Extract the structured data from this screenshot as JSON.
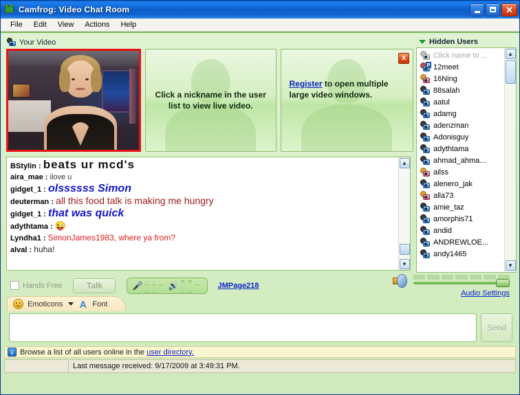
{
  "window": {
    "title": "Camfrog: Video Chat Room",
    "icon": "camfrog-logo-icon",
    "minimize_label": "Minimize",
    "maximize_label": "Maximize",
    "close_label": "Close"
  },
  "menu": {
    "items": [
      "File",
      "Edit",
      "View",
      "Actions",
      "Help"
    ]
  },
  "video": {
    "my_video_label": "Your Video",
    "placeholder1": "Click a nickname in the user list to view live video.",
    "placeholder2_link": "Register",
    "placeholder2_rest": " to open multiple large video windows.",
    "close_label": "x"
  },
  "chat": {
    "messages": [
      {
        "nick": "BStylin",
        "text": "beats ur mcd's",
        "style": "big"
      },
      {
        "nick": "aira_mae",
        "text": "ilove u",
        "style": "small"
      },
      {
        "nick": "gidget_1",
        "text": "olssssss  Simon",
        "style": "blue-italic"
      },
      {
        "nick": "deuterman",
        "text": "all this food talk is making me hungry",
        "style": "red"
      },
      {
        "nick": "gidget_1",
        "text": "that  was  quick",
        "style": "blue-italic"
      },
      {
        "nick": "adythtama",
        "text": "😜",
        "style": "emoticon"
      },
      {
        "nick": "Lyndha1",
        "text": "SimonJames1983,  where ya from?",
        "style": "red-small"
      },
      {
        "nick": "alval",
        "text": "huha!",
        "style": "plain"
      }
    ]
  },
  "userlist": {
    "header": "Hidden Users",
    "placeholder": "Click name to ...",
    "users": [
      {
        "name": "12meet",
        "icon": "user-pro-icon"
      },
      {
        "name": "16Ning",
        "icon": "user-gold-icon"
      },
      {
        "name": "88salah",
        "icon": "user-icon"
      },
      {
        "name": "aatul",
        "icon": "user-icon"
      },
      {
        "name": "adamg",
        "icon": "user-icon"
      },
      {
        "name": "adenzman",
        "icon": "user-icon"
      },
      {
        "name": "Adonisguy",
        "icon": "user-icon"
      },
      {
        "name": "adythtama",
        "icon": "user-icon"
      },
      {
        "name": "ahmad_ahma...",
        "icon": "user-icon"
      },
      {
        "name": "ailss",
        "icon": "user-gold-icon"
      },
      {
        "name": "alenero_jak",
        "icon": "user-icon"
      },
      {
        "name": "alla73",
        "icon": "user-gold-icon"
      },
      {
        "name": "amie_taz",
        "icon": "user-icon"
      },
      {
        "name": "amorphis71",
        "icon": "user-icon"
      },
      {
        "name": "andid",
        "icon": "user-icon"
      },
      {
        "name": "ANDREWLOE...",
        "icon": "user-icon"
      },
      {
        "name": "andy1465",
        "icon": "user-icon"
      }
    ]
  },
  "audio": {
    "hands_free_label": "Hands Free",
    "hands_free_checked": false,
    "talk_label": "Talk",
    "mic_icon": "microphone-icon",
    "speaker_icon": "speaker-icon",
    "meter_dashes": "_ _ _ _ _",
    "meter_dashes2": "= = _ _ _",
    "nickname_link": "JMPage218",
    "volume_icon": "volume-speaker-icon",
    "volume_level": 100,
    "audio_settings_link": "Audio Settings"
  },
  "toolbar": {
    "emoticons_label": "Emoticons",
    "emoticons_icon": "smiley-icon",
    "font_label": "Font",
    "font_icon": "font-a-icon"
  },
  "input": {
    "value": "",
    "placeholder": "",
    "send_label": "Send"
  },
  "info": {
    "icon": "info-icon",
    "text": "Browse a list of all users online in the ",
    "link": "user directory."
  },
  "status": {
    "message": "Last message received: 9/17/2009 at 3:49:31 PM."
  },
  "colors": {
    "title_blue": "#0d5fc8",
    "client_green": "#d6eec4",
    "accent_red": "#e81414",
    "link_blue": "#0a23c8"
  }
}
